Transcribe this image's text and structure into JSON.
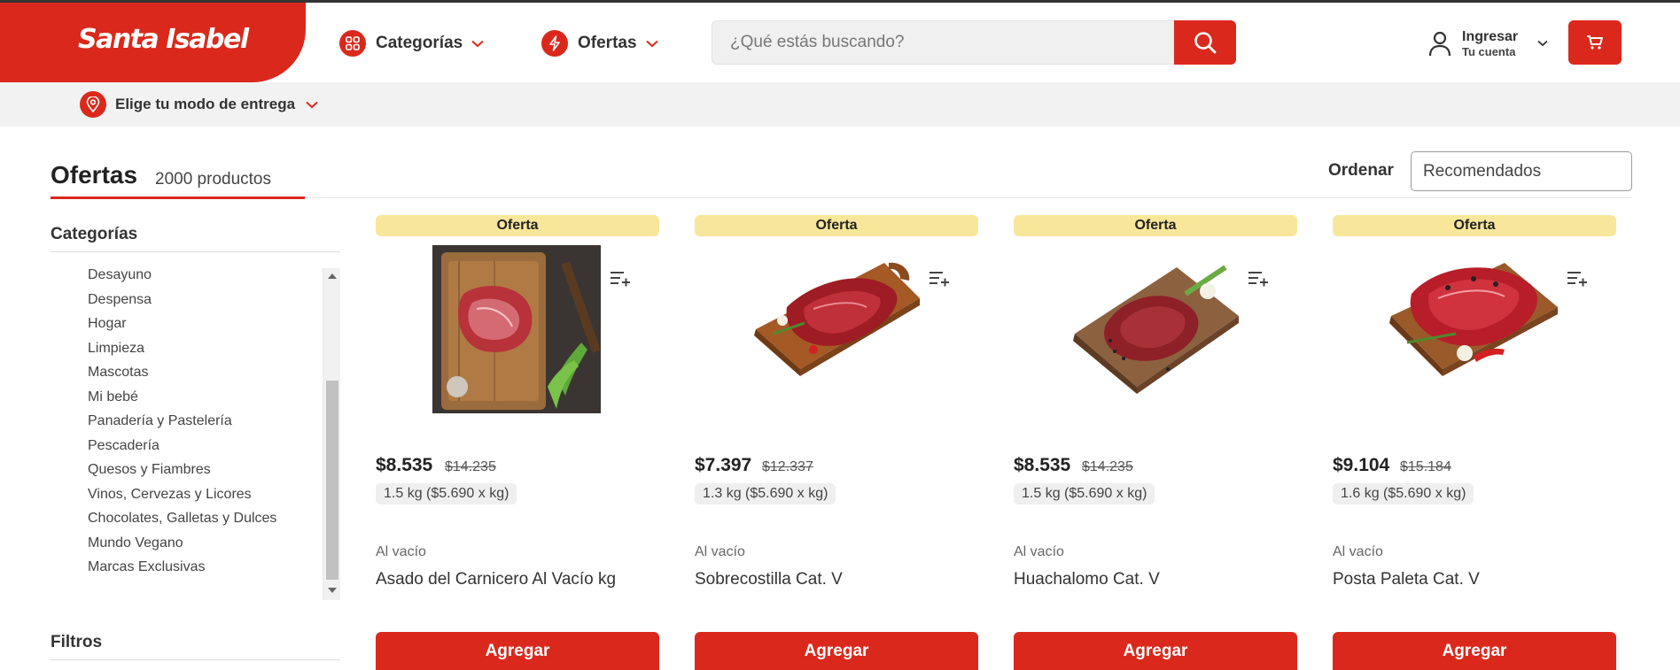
{
  "header": {
    "logo": "Santa Isabel",
    "categories_label": "Categorías",
    "offers_label": "Ofertas",
    "search_placeholder": "¿Qué estás buscando?",
    "login_label": "Ingresar",
    "account_label": "Tu cuenta"
  },
  "subbar": {
    "delivery_label": "Elige tu modo de entrega"
  },
  "page": {
    "title": "Ofertas",
    "count": "2000 productos",
    "sort_label": "Ordenar",
    "sort_value": "Recomendados"
  },
  "sidebar": {
    "categories_heading": "Categorías",
    "filters_heading": "Filtros",
    "categories": [
      "Desayuno",
      "Despensa",
      "Hogar",
      "Limpieza",
      "Mascotas",
      "Mi bebé",
      "Panadería y Pastelería",
      "Pescadería",
      "Quesos y Fiambres",
      "Vinos, Cervezas y Licores",
      "Chocolates, Galletas y Dulces",
      "Mundo Vegano",
      "Marcas Exclusivas"
    ]
  },
  "products": [
    {
      "badge": "Oferta",
      "price": "$8.535",
      "old_price": "$14.235",
      "unit": "1.5 kg ($5.690 x kg)",
      "brand": "Al vacío",
      "name": "Asado del Carnicero Al Vacío kg",
      "button": "Agregar",
      "image": "meat-on-board-dark-photo"
    },
    {
      "badge": "Oferta",
      "price": "$7.397",
      "old_price": "$12.337",
      "unit": "1.3 kg ($5.690 x kg)",
      "brand": "Al vacío",
      "name": "Sobrecostilla Cat. V",
      "button": "Agregar",
      "image": "meat-on-board-photo"
    },
    {
      "badge": "Oferta",
      "price": "$8.535",
      "old_price": "$14.235",
      "unit": "1.5 kg ($5.690 x kg)",
      "brand": "Al vacío",
      "name": "Huachalomo Cat. V",
      "button": "Agregar",
      "image": "meat-on-board-photo"
    },
    {
      "badge": "Oferta",
      "price": "$9.104",
      "old_price": "$15.184",
      "unit": "1.6 kg ($5.690 x kg)",
      "brand": "Al vacío",
      "name": "Posta Paleta Cat. V",
      "button": "Agregar",
      "image": "meat-on-board-photo"
    }
  ],
  "colors": {
    "brand_red": "#da291c",
    "offer_badge": "#f8e79a",
    "subbar": "#f2f2f2"
  },
  "icons": [
    "grid-icon",
    "bolt-icon",
    "chevron-down-icon",
    "search-icon",
    "user-icon",
    "cart-icon",
    "location-pin-icon",
    "add-to-list-icon"
  ]
}
